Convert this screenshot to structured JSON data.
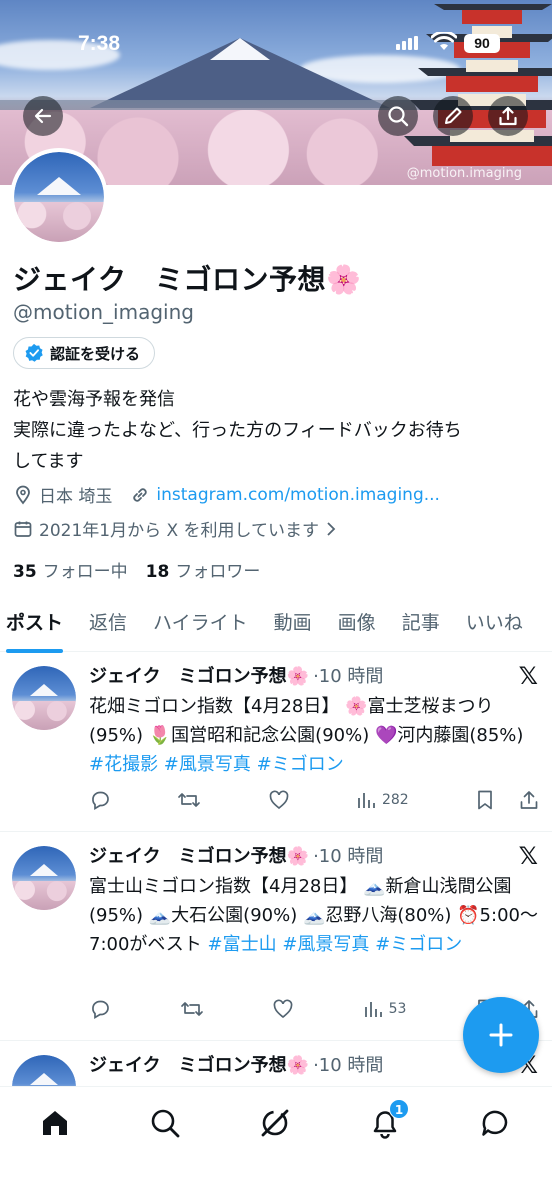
{
  "status_bar": {
    "time": "7:38",
    "battery": "90"
  },
  "banner": {
    "watermark": "@motion.imaging"
  },
  "profile": {
    "name": "ジェイク　ミゴロン予想🌸",
    "handle": "@motion_imaging",
    "verify_label": "認証を受ける",
    "bio_lines": [
      "花や雲海予報を発信",
      "実際に違ったよなど、行った方のフィードバックお待ち",
      "してます"
    ],
    "location": "日本 埼玉",
    "link": "instagram.com/motion.imaging...",
    "joined": "2021年1月から X を利用しています",
    "following_count": "35",
    "following_label": "フォロー中",
    "followers_count": "18",
    "followers_label": "フォロワー"
  },
  "tabs": [
    {
      "label": "ポスト",
      "active": true
    },
    {
      "label": "返信"
    },
    {
      "label": "ハイライト"
    },
    {
      "label": "動画"
    },
    {
      "label": "画像"
    },
    {
      "label": "記事"
    },
    {
      "label": "いいね"
    }
  ],
  "tweets": [
    {
      "author": "ジェイク　ミゴロン予想🌸",
      "time": "·10 時間",
      "text": "花畑ミゴロン指数【4月28日】 🌸富士芝桜まつり(95%) 🌷国営昭和記念公園(90%) 💜河内藤園(85%) ",
      "tags": "#花撮影 #風景写真 #ミゴロン",
      "views": "282"
    },
    {
      "author": "ジェイク　ミゴロン予想🌸",
      "time": "·10 時間",
      "text": "富士山ミゴロン指数【4月28日】 🗻新倉山浅間公園(95%) 🗻大石公園(90%) 🗻忍野八海(80%) ⏰5:00〜7:00がベスト ",
      "tags": "#富士山 #風景写真 #ミゴロン",
      "views": "53"
    },
    {
      "author": "ジェイク　ミゴロン予想🌸",
      "time": "·10 時間"
    }
  ],
  "nav": {
    "notification_badge": "1"
  },
  "colors": {
    "accent": "#1d9bf0",
    "text": "#0f1419",
    "muted": "#536471"
  }
}
